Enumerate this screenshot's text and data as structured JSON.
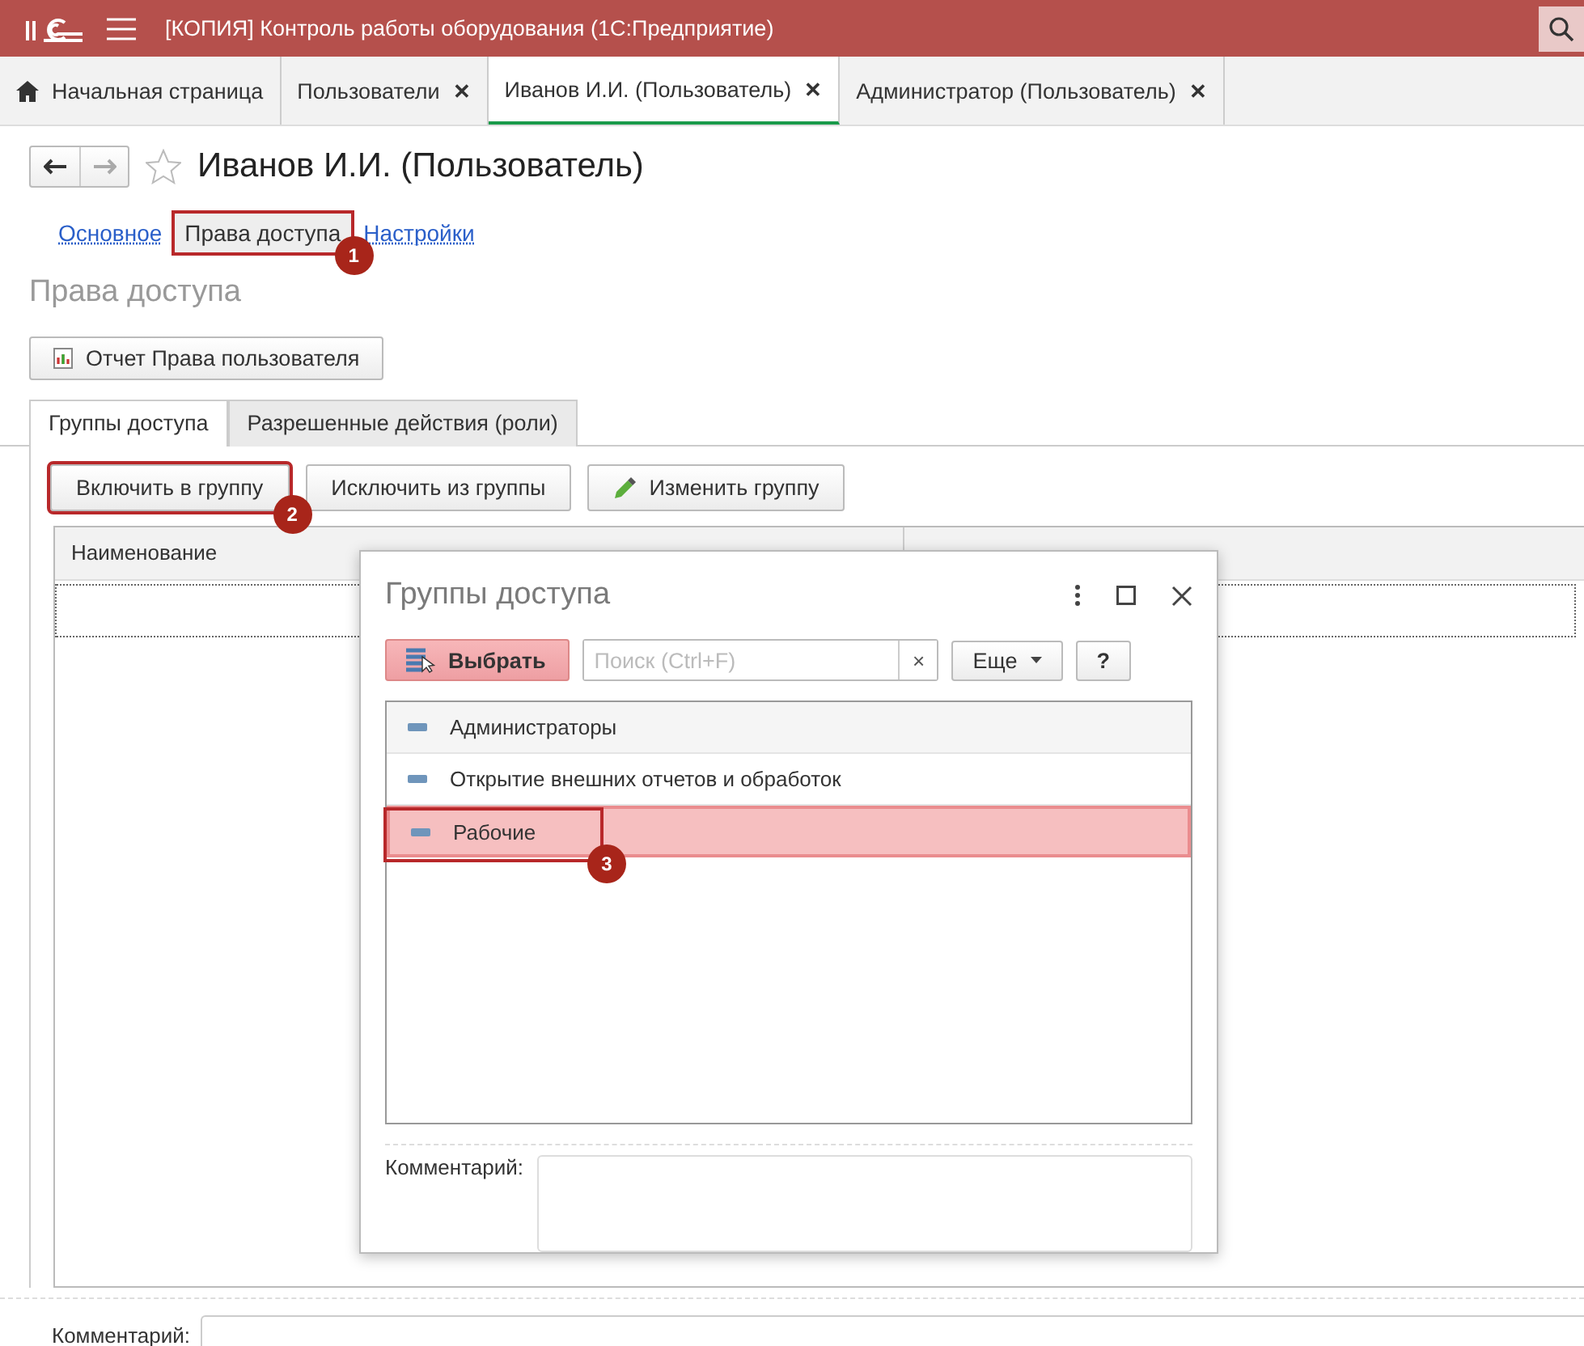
{
  "window": {
    "title": "[КОПИЯ] Контроль работы оборудования  (1С:Предприятие)"
  },
  "tabs": [
    {
      "label": "Начальная страница",
      "kind": "home",
      "selected": false
    },
    {
      "label": "Пользователи",
      "kind": "closable",
      "close": "✕",
      "selected": false
    },
    {
      "label": "Иванов И.И. (Пользователь)",
      "kind": "closable",
      "close": "✕",
      "selected": true
    },
    {
      "label": "Администратор (Пользователь)",
      "kind": "closable",
      "close": "✕",
      "selected": false
    }
  ],
  "form": {
    "title": "Иванов И.И. (Пользователь)",
    "sections": [
      {
        "label": "Основное",
        "selected": false
      },
      {
        "label": "Права доступа",
        "selected": true,
        "marker": "1"
      },
      {
        "label": "Настройки",
        "selected": false
      }
    ],
    "heading": "Права доступа",
    "report_button": "Отчет Права пользователя",
    "subtabs": [
      {
        "label": "Группы доступа",
        "selected": true
      },
      {
        "label": "Разрешенные действия (роли)",
        "selected": false
      }
    ],
    "buttons": [
      {
        "label": "Включить в группу",
        "kind": "plain",
        "marker": "2"
      },
      {
        "label": "Исключить из группы",
        "kind": "plain"
      },
      {
        "label": "Изменить группу",
        "kind": "edit"
      }
    ],
    "table": {
      "columns": [
        "Наименование"
      ]
    },
    "comment_label": "Комментарий:"
  },
  "dialog": {
    "title": "Группы доступа",
    "select_button": "Выбрать",
    "search": {
      "placeholder": "Поиск (Ctrl+F)"
    },
    "clear": "×",
    "more_button": "Еще",
    "help_button": "?",
    "items": [
      {
        "label": "Администраторы",
        "selected": false
      },
      {
        "label": "Открытие внешних отчетов и обработок",
        "selected": false
      },
      {
        "label": "Рабочие",
        "selected": true,
        "marker": "3"
      }
    ],
    "comment_label": "Комментарий:"
  }
}
